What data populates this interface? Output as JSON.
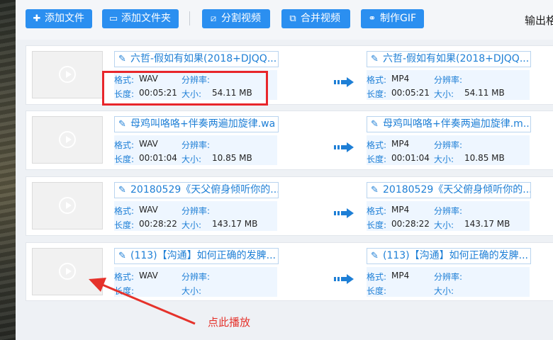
{
  "toolbar": {
    "add_file": "添加文件",
    "add_folder": "添加文件夹",
    "split_video": "分割视频",
    "merge_video": "合并视频",
    "make_gif": "制作GIF",
    "output_label": "输出格"
  },
  "labels": {
    "format": "格式:",
    "resolution": "分辨率:",
    "duration": "长度:",
    "size": "大小:"
  },
  "files": [
    {
      "source_name": "六哲-假如有如果(2018+DJQQ...",
      "target_name": "六哲-假如有如果(2018+DJQQ...",
      "source_format": "WAV",
      "target_format": "MP4",
      "duration": "00:05:21",
      "size": "54.11 MB"
    },
    {
      "source_name": "母鸡叫咯咯+伴奏两遍加旋律.wa",
      "target_name": "母鸡叫咯咯+伴奏两遍加旋律.m...",
      "source_format": "WAV",
      "target_format": "MP4",
      "duration": "00:01:04",
      "size": "10.85 MB"
    },
    {
      "source_name": "20180529《天父俯身倾听你的...",
      "target_name": "20180529《天父俯身倾听你的...",
      "source_format": "WAV",
      "target_format": "MP4",
      "duration": "00:28:22",
      "size": "143.17 MB"
    },
    {
      "source_name": "(113)【沟通】如何正确的发脾...",
      "target_name": "(113)【沟通】如何正确的发脾...",
      "source_format": "WAV",
      "target_format": "MP4",
      "duration": "",
      "size": ""
    }
  ],
  "annotation": {
    "text": "点此播放",
    "color": "#e5322b"
  },
  "colors": {
    "accent": "#2b8ff0",
    "highlight_box": "#e8262b"
  }
}
